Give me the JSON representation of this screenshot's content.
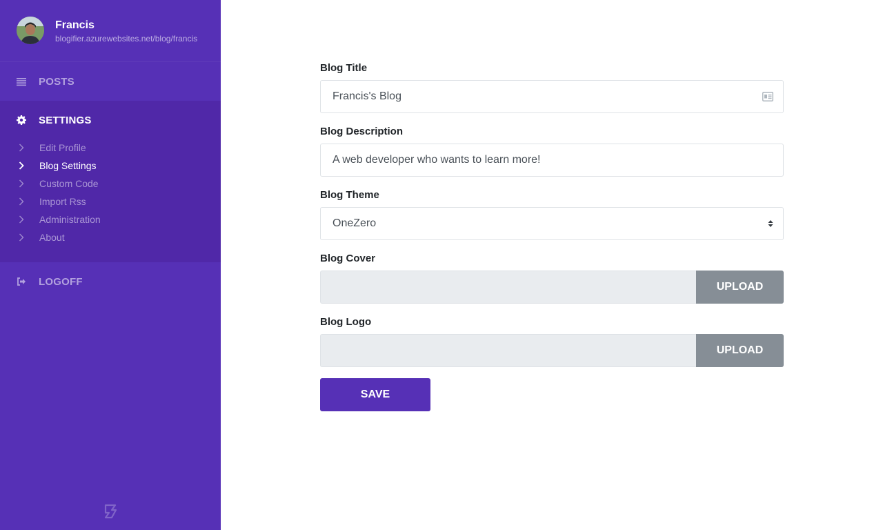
{
  "profile": {
    "name": "Francis",
    "url": "blogifier.azurewebsites.net/blog/francis"
  },
  "nav": {
    "posts": {
      "label": "POSTS",
      "icon": "list-icon"
    },
    "settings": {
      "label": "SETTINGS",
      "icon": "gear-icon"
    },
    "logoff": {
      "label": "LOGOFF",
      "icon": "sign-out-icon"
    }
  },
  "settings_menu": [
    {
      "label": "Edit Profile",
      "active": false
    },
    {
      "label": "Blog Settings",
      "active": true
    },
    {
      "label": "Custom Code",
      "active": false
    },
    {
      "label": "Import Rss",
      "active": false
    },
    {
      "label": "Administration",
      "active": false
    },
    {
      "label": "About",
      "active": false
    }
  ],
  "form": {
    "title_label": "Blog Title",
    "title_value": "Francis's Blog",
    "description_label": "Blog Description",
    "description_value": "A web developer who wants to learn more!",
    "theme_label": "Blog Theme",
    "theme_value": "OneZero",
    "cover_label": "Blog Cover",
    "cover_upload": "UPLOAD",
    "logo_label": "Blog Logo",
    "logo_upload": "UPLOAD",
    "save_label": "SAVE"
  },
  "colors": {
    "sidebar": "#5630b6",
    "sidebar_active_block": "#5028a8",
    "upload_button": "#868e96",
    "save_button": "#5630b6"
  }
}
